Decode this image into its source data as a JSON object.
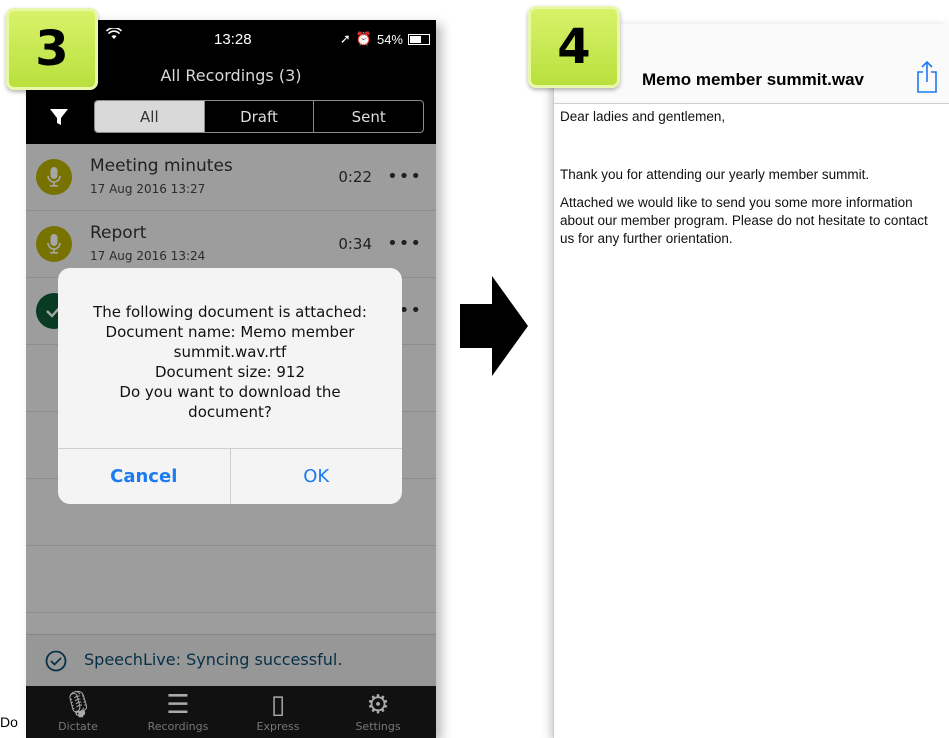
{
  "step3": {
    "badge": "3",
    "status": {
      "time": "13:28",
      "battery": "54%",
      "battery_level": 0.54
    },
    "title": "All Recordings (3)",
    "segments": [
      "All",
      "Draft",
      "Sent"
    ],
    "recordings": [
      {
        "title": "Meeting minutes",
        "date": "17 Aug 2016 13:27",
        "duration": "0:22",
        "more": "•••"
      },
      {
        "title": "Report",
        "date": "17 Aug 2016 13:24",
        "duration": "0:34",
        "more": "•••"
      },
      {
        "more": "••"
      }
    ],
    "alert": {
      "lines": [
        "The following document is attached:",
        "Document name: Memo member",
        "summit.wav.rtf",
        "Document size: 912",
        "Do you want to download the",
        "document?"
      ],
      "cancel": "Cancel",
      "ok": "OK"
    },
    "sync": "SpeechLive: Syncing successful.",
    "tabs": [
      "Dictate",
      "Recordings",
      "Express",
      "Settings"
    ]
  },
  "step4": {
    "badge": "4",
    "title": "Memo member summit.wav",
    "body": [
      "Dear ladies and gentlemen,",
      "Thank you for attending our yearly member summit.",
      "Attached we would like to send you some more information about our member program. Please do not hesitate to contact us for any further orientation."
    ]
  },
  "caption": "Do"
}
